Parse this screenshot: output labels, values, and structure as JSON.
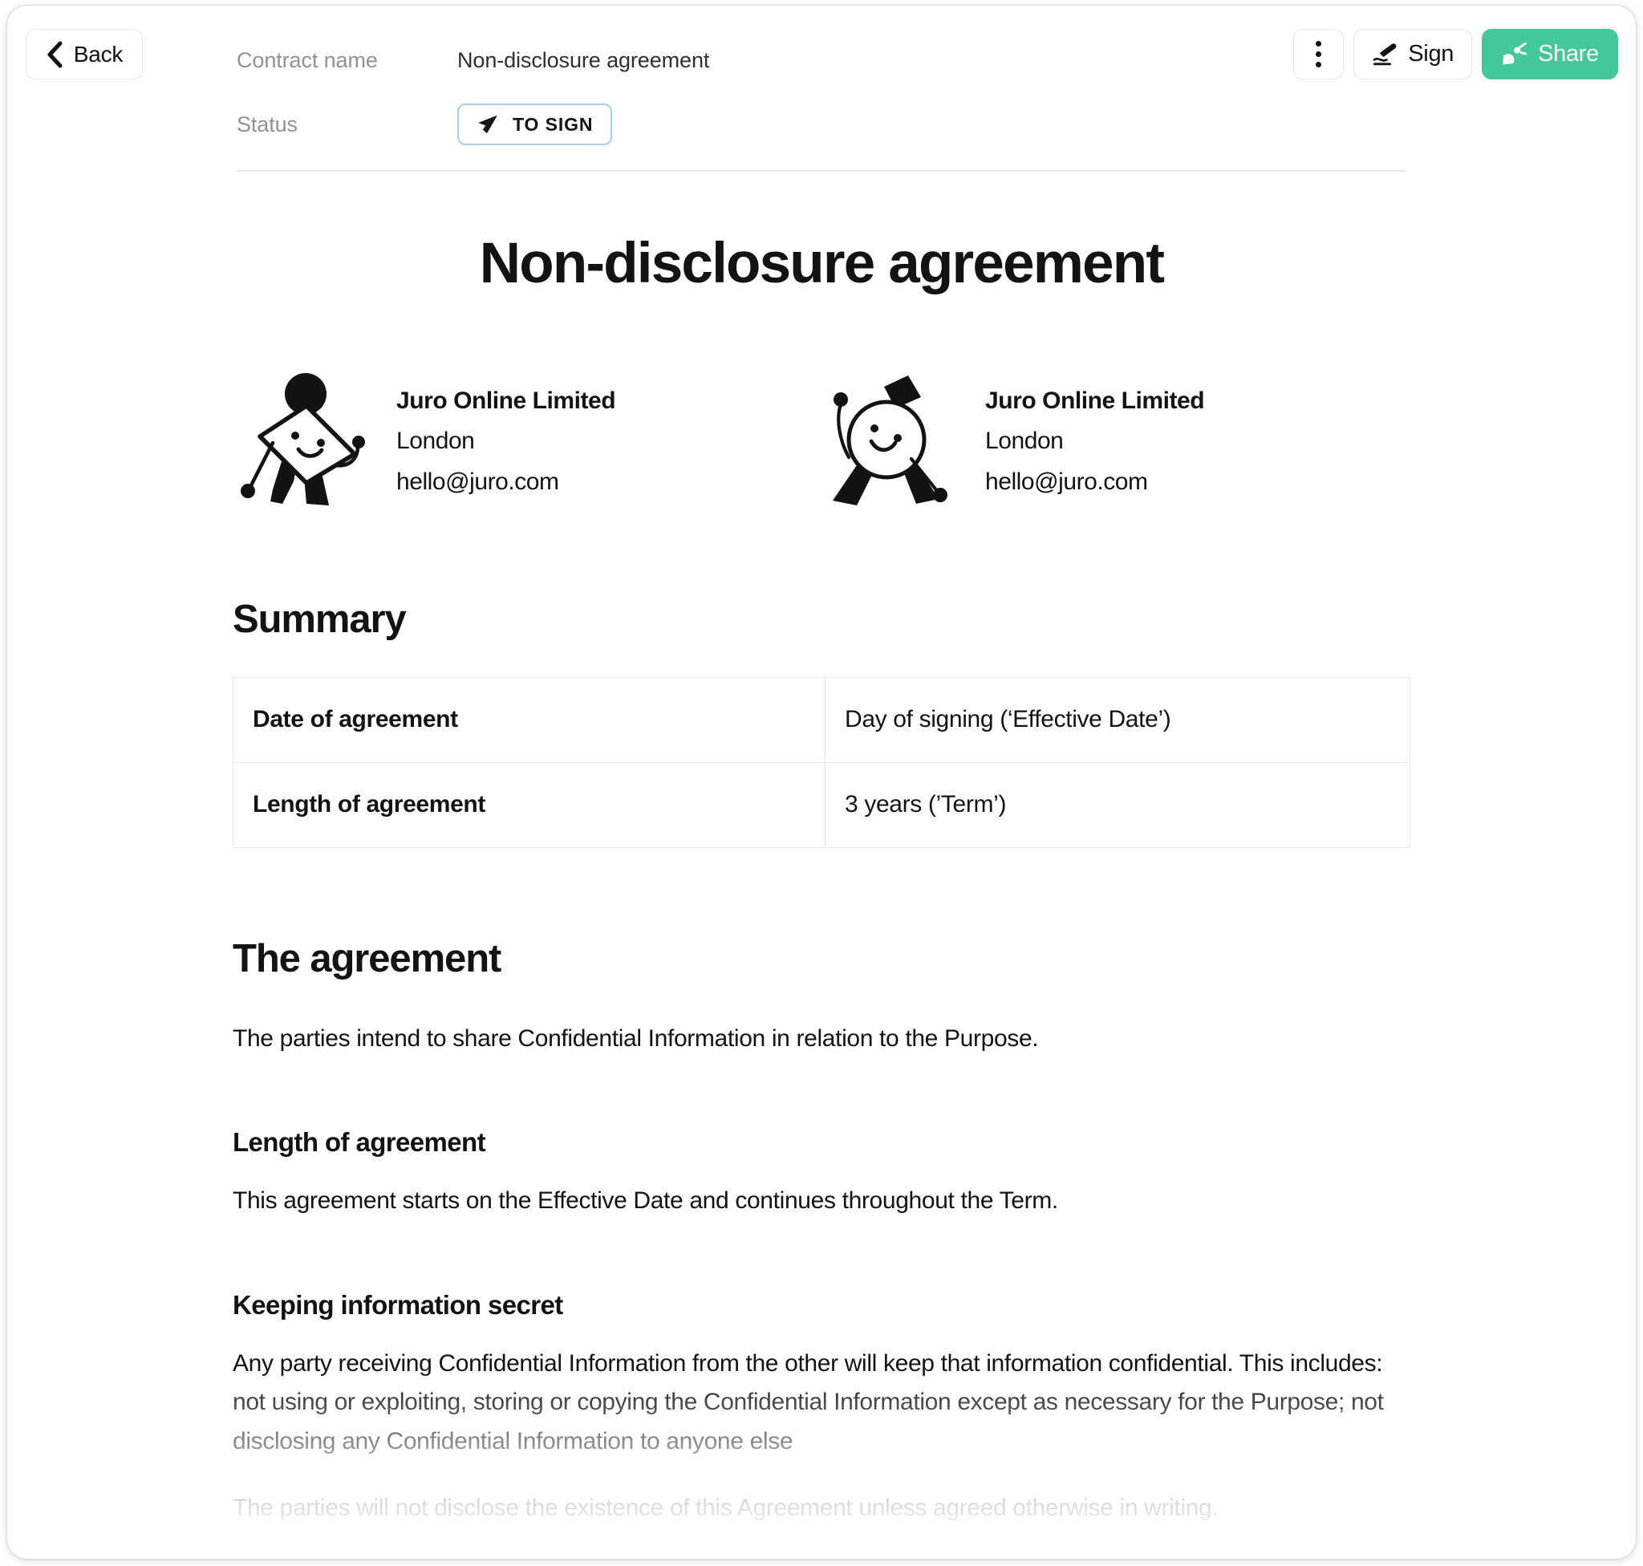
{
  "window": {
    "accent_green": "#45c79b",
    "status_border_blue": "#a8cfe2"
  },
  "topbar": {
    "back_label": "Back",
    "contract_name_label": "Contract name",
    "contract_name_value": "Non-disclosure agreement",
    "status_label": "Status",
    "status_value": "TO SIGN",
    "sign_label": "Sign",
    "share_label": "Share"
  },
  "document": {
    "title": "Non-disclosure agreement",
    "parties": [
      {
        "name": "Juro Online Limited",
        "city": "London",
        "email": "hello@juro.com",
        "avatar": "diamond-figure-avatar"
      },
      {
        "name": "Juro Online Limited",
        "city": "London",
        "email": "hello@juro.com",
        "avatar": "hat-figure-avatar"
      }
    ],
    "summary": {
      "heading": "Summary",
      "rows": [
        {
          "key": "Date of agreement",
          "value": "Day of signing (‘Effective Date’)"
        },
        {
          "key": "Length of agreement",
          "value": "3 years (’Term’)"
        }
      ]
    },
    "agreement": {
      "heading": "The agreement",
      "intro": "The parties intend to share Confidential Information in relation to the Purpose.",
      "sections": [
        {
          "heading": "Length of agreement",
          "paragraphs": [
            "This agreement starts on the Effective Date and continues throughout the Term."
          ]
        },
        {
          "heading": "Keeping information secret",
          "paragraphs": [
            "Any party receiving Confidential Information from the other will keep that information confidential. This includes: not using or exploiting, storing or copying the Confidential Information except as necessary for the Purpose; not disclosing any Confidential Information to anyone else",
            "The parties will not disclose the existence of this Agreement unless agreed otherwise in writing."
          ]
        }
      ]
    }
  }
}
